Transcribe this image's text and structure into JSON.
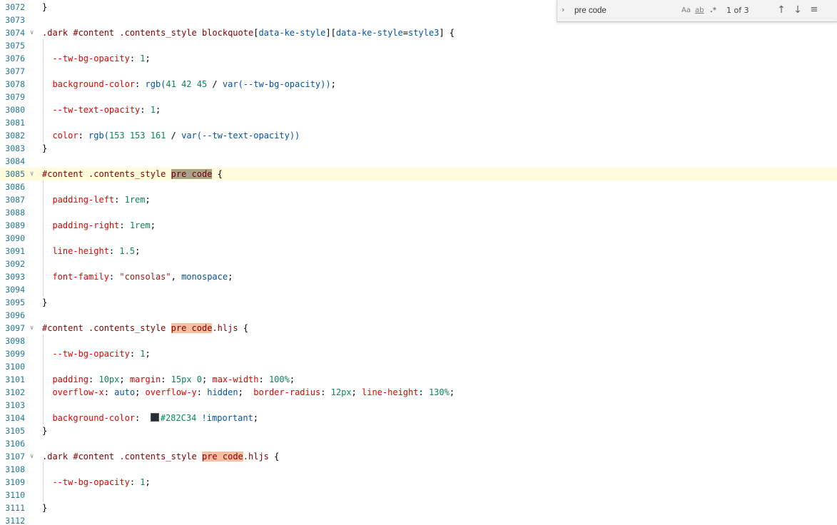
{
  "editor": {
    "lines": [
      {
        "num": "3072",
        "tokens": [
          {
            "t": "}",
            "c": "t-punc"
          }
        ]
      },
      {
        "num": "3073",
        "tokens": []
      },
      {
        "num": "3074",
        "fold": true,
        "tokens": [
          {
            "t": ".dark #content .contents_style blockquote",
            "c": "t-sel"
          },
          {
            "t": "[",
            "c": "t-punc"
          },
          {
            "t": "data-ke-style",
            "c": "t-attr"
          },
          {
            "t": "][",
            "c": "t-punc"
          },
          {
            "t": "data-ke-style",
            "c": "t-attr"
          },
          {
            "t": "=",
            "c": "t-punc"
          },
          {
            "t": "style3",
            "c": "t-attr"
          },
          {
            "t": "] {",
            "c": "t-punc"
          }
        ]
      },
      {
        "num": "3075",
        "guide": true,
        "tokens": []
      },
      {
        "num": "3076",
        "guide": true,
        "tokens": [
          {
            "t": "  --tw-bg-opacity",
            "c": "t-prop"
          },
          {
            "t": ": ",
            "c": "t-punc"
          },
          {
            "t": "1",
            "c": "t-num"
          },
          {
            "t": ";",
            "c": "t-punc"
          }
        ]
      },
      {
        "num": "3077",
        "guide": true,
        "tokens": []
      },
      {
        "num": "3078",
        "guide": true,
        "tokens": [
          {
            "t": "  background-color",
            "c": "t-prop"
          },
          {
            "t": ": ",
            "c": "t-punc"
          },
          {
            "t": "rgb(",
            "c": "t-kw"
          },
          {
            "t": "41 42 45",
            "c": "t-num"
          },
          {
            "t": " / ",
            "c": "t-punc"
          },
          {
            "t": "var(--tw-bg-opacity))",
            "c": "t-kw"
          },
          {
            "t": ";",
            "c": "t-punc"
          }
        ]
      },
      {
        "num": "3079",
        "guide": true,
        "tokens": []
      },
      {
        "num": "3080",
        "guide": true,
        "tokens": [
          {
            "t": "  --tw-text-opacity",
            "c": "t-prop"
          },
          {
            "t": ": ",
            "c": "t-punc"
          },
          {
            "t": "1",
            "c": "t-num"
          },
          {
            "t": ";",
            "c": "t-punc"
          }
        ]
      },
      {
        "num": "3081",
        "guide": true,
        "tokens": []
      },
      {
        "num": "3082",
        "guide": true,
        "tokens": [
          {
            "t": "  color",
            "c": "t-prop"
          },
          {
            "t": ": ",
            "c": "t-punc"
          },
          {
            "t": "rgb(",
            "c": "t-kw"
          },
          {
            "t": "153 153 161",
            "c": "t-num"
          },
          {
            "t": " / ",
            "c": "t-punc"
          },
          {
            "t": "var(--tw-text-opacity))",
            "c": "t-kw"
          }
        ]
      },
      {
        "num": "3083",
        "tokens": [
          {
            "t": "}",
            "c": "t-punc"
          }
        ]
      },
      {
        "num": "3084",
        "tokens": []
      },
      {
        "num": "3085",
        "fold": true,
        "current": true,
        "tokens": [
          {
            "t": "#content .contents_style ",
            "c": "t-sel"
          },
          {
            "t": "pre code",
            "c": "t-sel",
            "hl": "active"
          },
          {
            "t": " {",
            "c": "t-punc"
          }
        ]
      },
      {
        "num": "3086",
        "guide": true,
        "tokens": []
      },
      {
        "num": "3087",
        "guide": true,
        "tokens": [
          {
            "t": "  padding-left",
            "c": "t-prop"
          },
          {
            "t": ": ",
            "c": "t-punc"
          },
          {
            "t": "1rem",
            "c": "t-num"
          },
          {
            "t": ";",
            "c": "t-punc"
          }
        ]
      },
      {
        "num": "3088",
        "guide": true,
        "tokens": []
      },
      {
        "num": "3089",
        "guide": true,
        "tokens": [
          {
            "t": "  padding-right",
            "c": "t-prop"
          },
          {
            "t": ": ",
            "c": "t-punc"
          },
          {
            "t": "1rem",
            "c": "t-num"
          },
          {
            "t": ";",
            "c": "t-punc"
          }
        ]
      },
      {
        "num": "3090",
        "guide": true,
        "tokens": []
      },
      {
        "num": "3091",
        "guide": true,
        "tokens": [
          {
            "t": "  line-height",
            "c": "t-prop"
          },
          {
            "t": ": ",
            "c": "t-punc"
          },
          {
            "t": "1.5",
            "c": "t-num"
          },
          {
            "t": ";",
            "c": "t-punc"
          }
        ]
      },
      {
        "num": "3092",
        "guide": true,
        "tokens": []
      },
      {
        "num": "3093",
        "guide": true,
        "tokens": [
          {
            "t": "  font-family",
            "c": "t-prop"
          },
          {
            "t": ": ",
            "c": "t-punc"
          },
          {
            "t": "\"consolas\"",
            "c": "t-str"
          },
          {
            "t": ", ",
            "c": "t-punc"
          },
          {
            "t": "monospace",
            "c": "t-kw"
          },
          {
            "t": ";",
            "c": "t-punc"
          }
        ]
      },
      {
        "num": "3094",
        "guide": true,
        "tokens": []
      },
      {
        "num": "3095",
        "tokens": [
          {
            "t": "}",
            "c": "t-punc"
          }
        ]
      },
      {
        "num": "3096",
        "tokens": []
      },
      {
        "num": "3097",
        "fold": true,
        "tokens": [
          {
            "t": "#content .contents_style ",
            "c": "t-sel"
          },
          {
            "t": "pre code",
            "c": "t-sel",
            "hl": "match"
          },
          {
            "t": ".hljs",
            "c": "t-sel"
          },
          {
            "t": " {",
            "c": "t-punc"
          }
        ]
      },
      {
        "num": "3098",
        "guide": true,
        "tokens": []
      },
      {
        "num": "3099",
        "guide": true,
        "tokens": [
          {
            "t": "  --tw-bg-opacity",
            "c": "t-prop"
          },
          {
            "t": ": ",
            "c": "t-punc"
          },
          {
            "t": "1",
            "c": "t-num"
          },
          {
            "t": ";",
            "c": "t-punc"
          }
        ]
      },
      {
        "num": "3100",
        "guide": true,
        "tokens": []
      },
      {
        "num": "3101",
        "guide": true,
        "tokens": [
          {
            "t": "  padding",
            "c": "t-prop"
          },
          {
            "t": ": ",
            "c": "t-punc"
          },
          {
            "t": "10px",
            "c": "t-num"
          },
          {
            "t": "; ",
            "c": "t-punc"
          },
          {
            "t": "margin",
            "c": "t-prop"
          },
          {
            "t": ": ",
            "c": "t-punc"
          },
          {
            "t": "15px 0",
            "c": "t-num"
          },
          {
            "t": "; ",
            "c": "t-punc"
          },
          {
            "t": "max-width",
            "c": "t-prop"
          },
          {
            "t": ": ",
            "c": "t-punc"
          },
          {
            "t": "100%",
            "c": "t-num"
          },
          {
            "t": ";",
            "c": "t-punc"
          }
        ]
      },
      {
        "num": "3102",
        "guide": true,
        "tokens": [
          {
            "t": "  overflow-x",
            "c": "t-prop"
          },
          {
            "t": ": ",
            "c": "t-punc"
          },
          {
            "t": "auto",
            "c": "t-kw"
          },
          {
            "t": "; ",
            "c": "t-punc"
          },
          {
            "t": "overflow-y",
            "c": "t-prop"
          },
          {
            "t": ": ",
            "c": "t-punc"
          },
          {
            "t": "hidden",
            "c": "t-kw"
          },
          {
            "t": ";  ",
            "c": "t-punc"
          },
          {
            "t": "border-radius",
            "c": "t-prop"
          },
          {
            "t": ": ",
            "c": "t-punc"
          },
          {
            "t": "12px",
            "c": "t-num"
          },
          {
            "t": "; ",
            "c": "t-punc"
          },
          {
            "t": "line-height",
            "c": "t-prop"
          },
          {
            "t": ": ",
            "c": "t-punc"
          },
          {
            "t": "130%",
            "c": "t-num"
          },
          {
            "t": ";",
            "c": "t-punc"
          }
        ]
      },
      {
        "num": "3103",
        "guide": true,
        "tokens": []
      },
      {
        "num": "3104",
        "guide": true,
        "tokens": [
          {
            "t": "  background-color",
            "c": "t-prop"
          },
          {
            "t": ":  ",
            "c": "t-punc"
          },
          {
            "swatch": "#282C34"
          },
          {
            "t": "#282C34",
            "c": "t-num"
          },
          {
            "t": " ",
            "c": "t-punc"
          },
          {
            "t": "!important",
            "c": "t-kw"
          },
          {
            "t": ";",
            "c": "t-punc"
          }
        ]
      },
      {
        "num": "3105",
        "tokens": [
          {
            "t": "}",
            "c": "t-punc"
          }
        ]
      },
      {
        "num": "3106",
        "tokens": []
      },
      {
        "num": "3107",
        "fold": true,
        "tokens": [
          {
            "t": ".dark #content .contents_style ",
            "c": "t-sel"
          },
          {
            "t": "pre code",
            "c": "t-sel",
            "hl": "match"
          },
          {
            "t": ".hljs",
            "c": "t-sel"
          },
          {
            "t": " {",
            "c": "t-punc"
          }
        ]
      },
      {
        "num": "3108",
        "guide": true,
        "tokens": []
      },
      {
        "num": "3109",
        "guide": true,
        "tokens": [
          {
            "t": "  --tw-bg-opacity",
            "c": "t-prop"
          },
          {
            "t": ": ",
            "c": "t-punc"
          },
          {
            "t": "1",
            "c": "t-num"
          },
          {
            "t": ";",
            "c": "t-punc"
          }
        ]
      },
      {
        "num": "3110",
        "guide": true,
        "tokens": []
      },
      {
        "num": "3111",
        "tokens": [
          {
            "t": "}",
            "c": "t-punc"
          }
        ]
      },
      {
        "num": "3112",
        "tokens": []
      }
    ]
  },
  "find_widget": {
    "query": "pre code",
    "match_case_label": "Aa",
    "whole_word_label": "ab",
    "regex_label": ".*",
    "match_count": "1 of 3",
    "toggle_icon": "chevron-right-icon",
    "prev_icon": "arrow-up-icon",
    "next_icon": "arrow-down-icon",
    "selection_icon": "find-in-selection-icon"
  }
}
